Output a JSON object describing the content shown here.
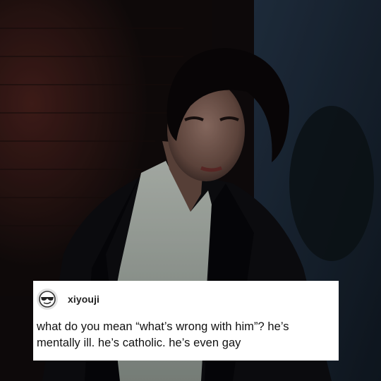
{
  "post": {
    "username": "xiyouji",
    "avatar_icon": "sunglasses-emoji-icon",
    "text_lines": [
      "what do you mean “what’s wrong with him”? he’s",
      "mentally ill. he’s catholic. he’s even gay"
    ]
  },
  "colors": {
    "card_background": "#ffffff",
    "text": "#111111",
    "photo_dark": "#0f0c0d",
    "brick_red": "#3a1a18",
    "night_blue": "#1b2a3a"
  }
}
